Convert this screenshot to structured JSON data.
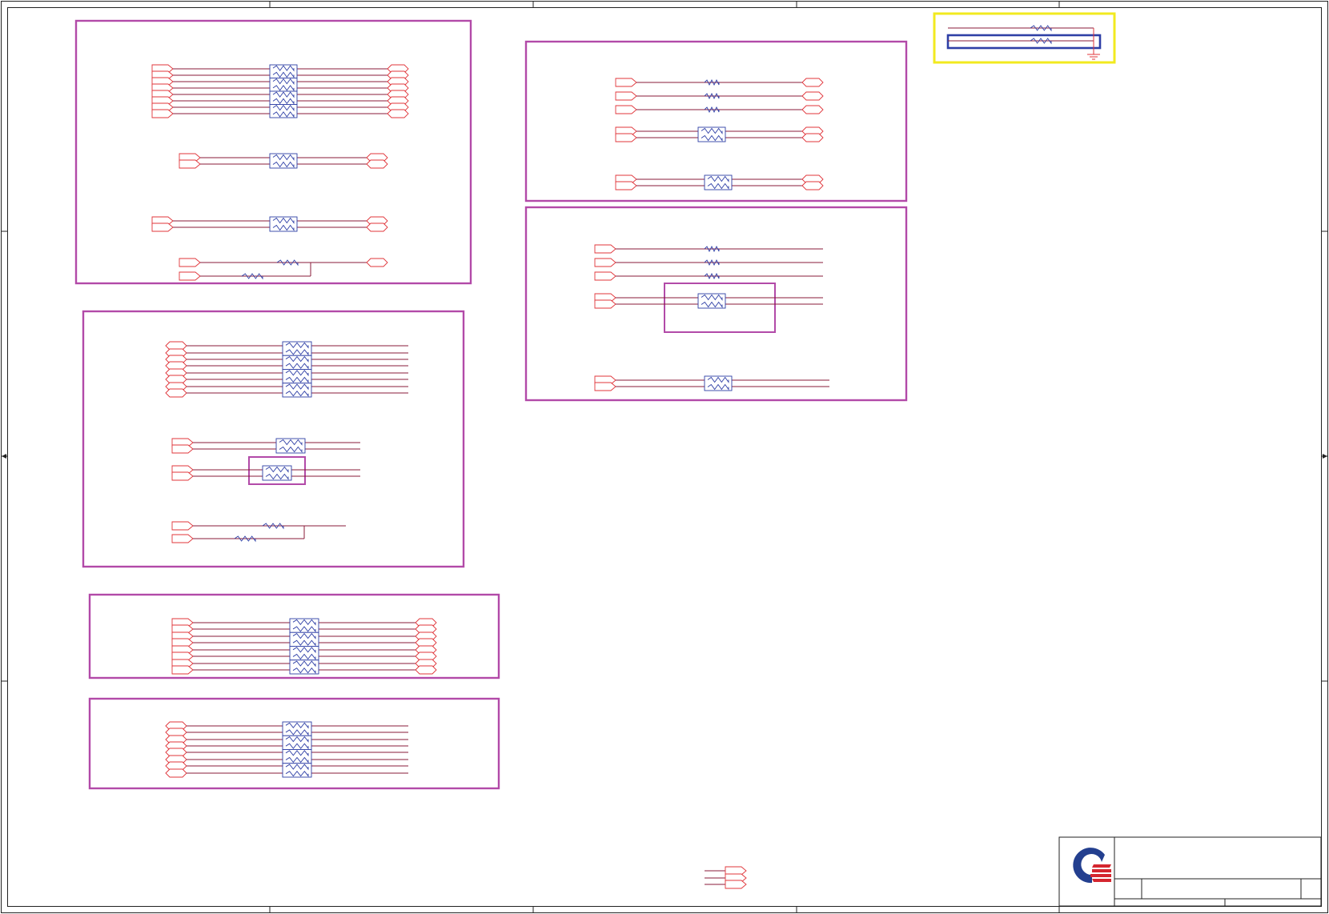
{
  "sheet": {
    "title": "",
    "blocks": [
      {
        "id": "block-a",
        "label": ""
      },
      {
        "id": "block-b",
        "label": ""
      },
      {
        "id": "block-c",
        "label": ""
      },
      {
        "id": "block-d",
        "label": ""
      },
      {
        "id": "block-e",
        "label": ""
      },
      {
        "id": "block-f",
        "label": ""
      }
    ]
  },
  "colors": {
    "block_border": "#b24aa8",
    "net": "#8a1b3a",
    "port": "#e0353a",
    "component": "#2e3fa6",
    "highlight_yellow": "#f2ea1f",
    "highlight_blue": "#2e3fa6",
    "logo_blue": "#233f8f",
    "logo_red": "#d4262f"
  },
  "title_block": {
    "logo": "company-logo",
    "title": "",
    "doc_number": "",
    "rev": "",
    "sheet": ""
  }
}
